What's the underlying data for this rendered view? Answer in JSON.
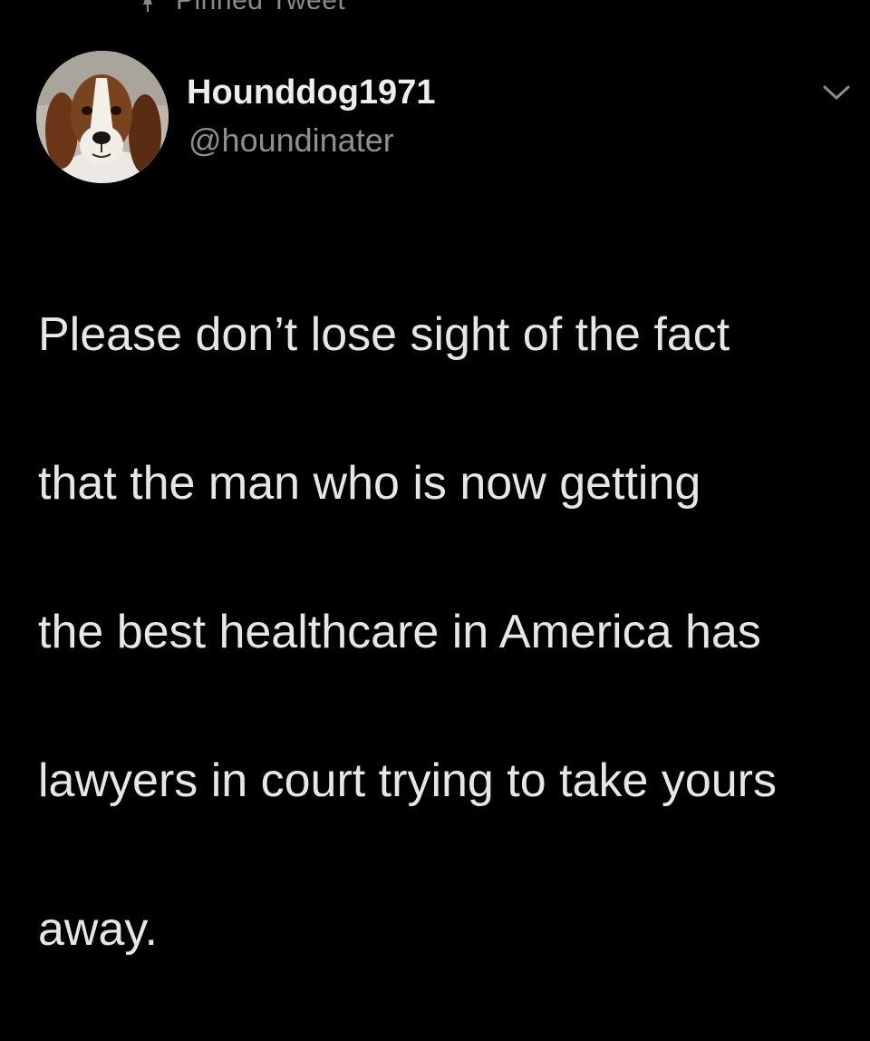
{
  "pinned": {
    "label": "Pinned Tweet",
    "icon": "pin-icon"
  },
  "author": {
    "display_name": "Hounddog1971",
    "handle": "@houndinater",
    "avatar": "basset-hound-avatar"
  },
  "menu": {
    "icon": "chevron-down-icon"
  },
  "tweet": {
    "text": "Please don’t lose sight of the fact that the man who is now getting the best healthcare in America has lawyers in court trying to take yours away.",
    "lines": [
      "Please don’t lose sight of the fact",
      "that the man who is now getting",
      "the best healthcare in America has",
      "lawyers in court trying to take yours",
      "away."
    ]
  },
  "colors": {
    "background": "#000000",
    "primary_text": "#e6e6e6",
    "secondary_text": "#8f8f8f"
  }
}
